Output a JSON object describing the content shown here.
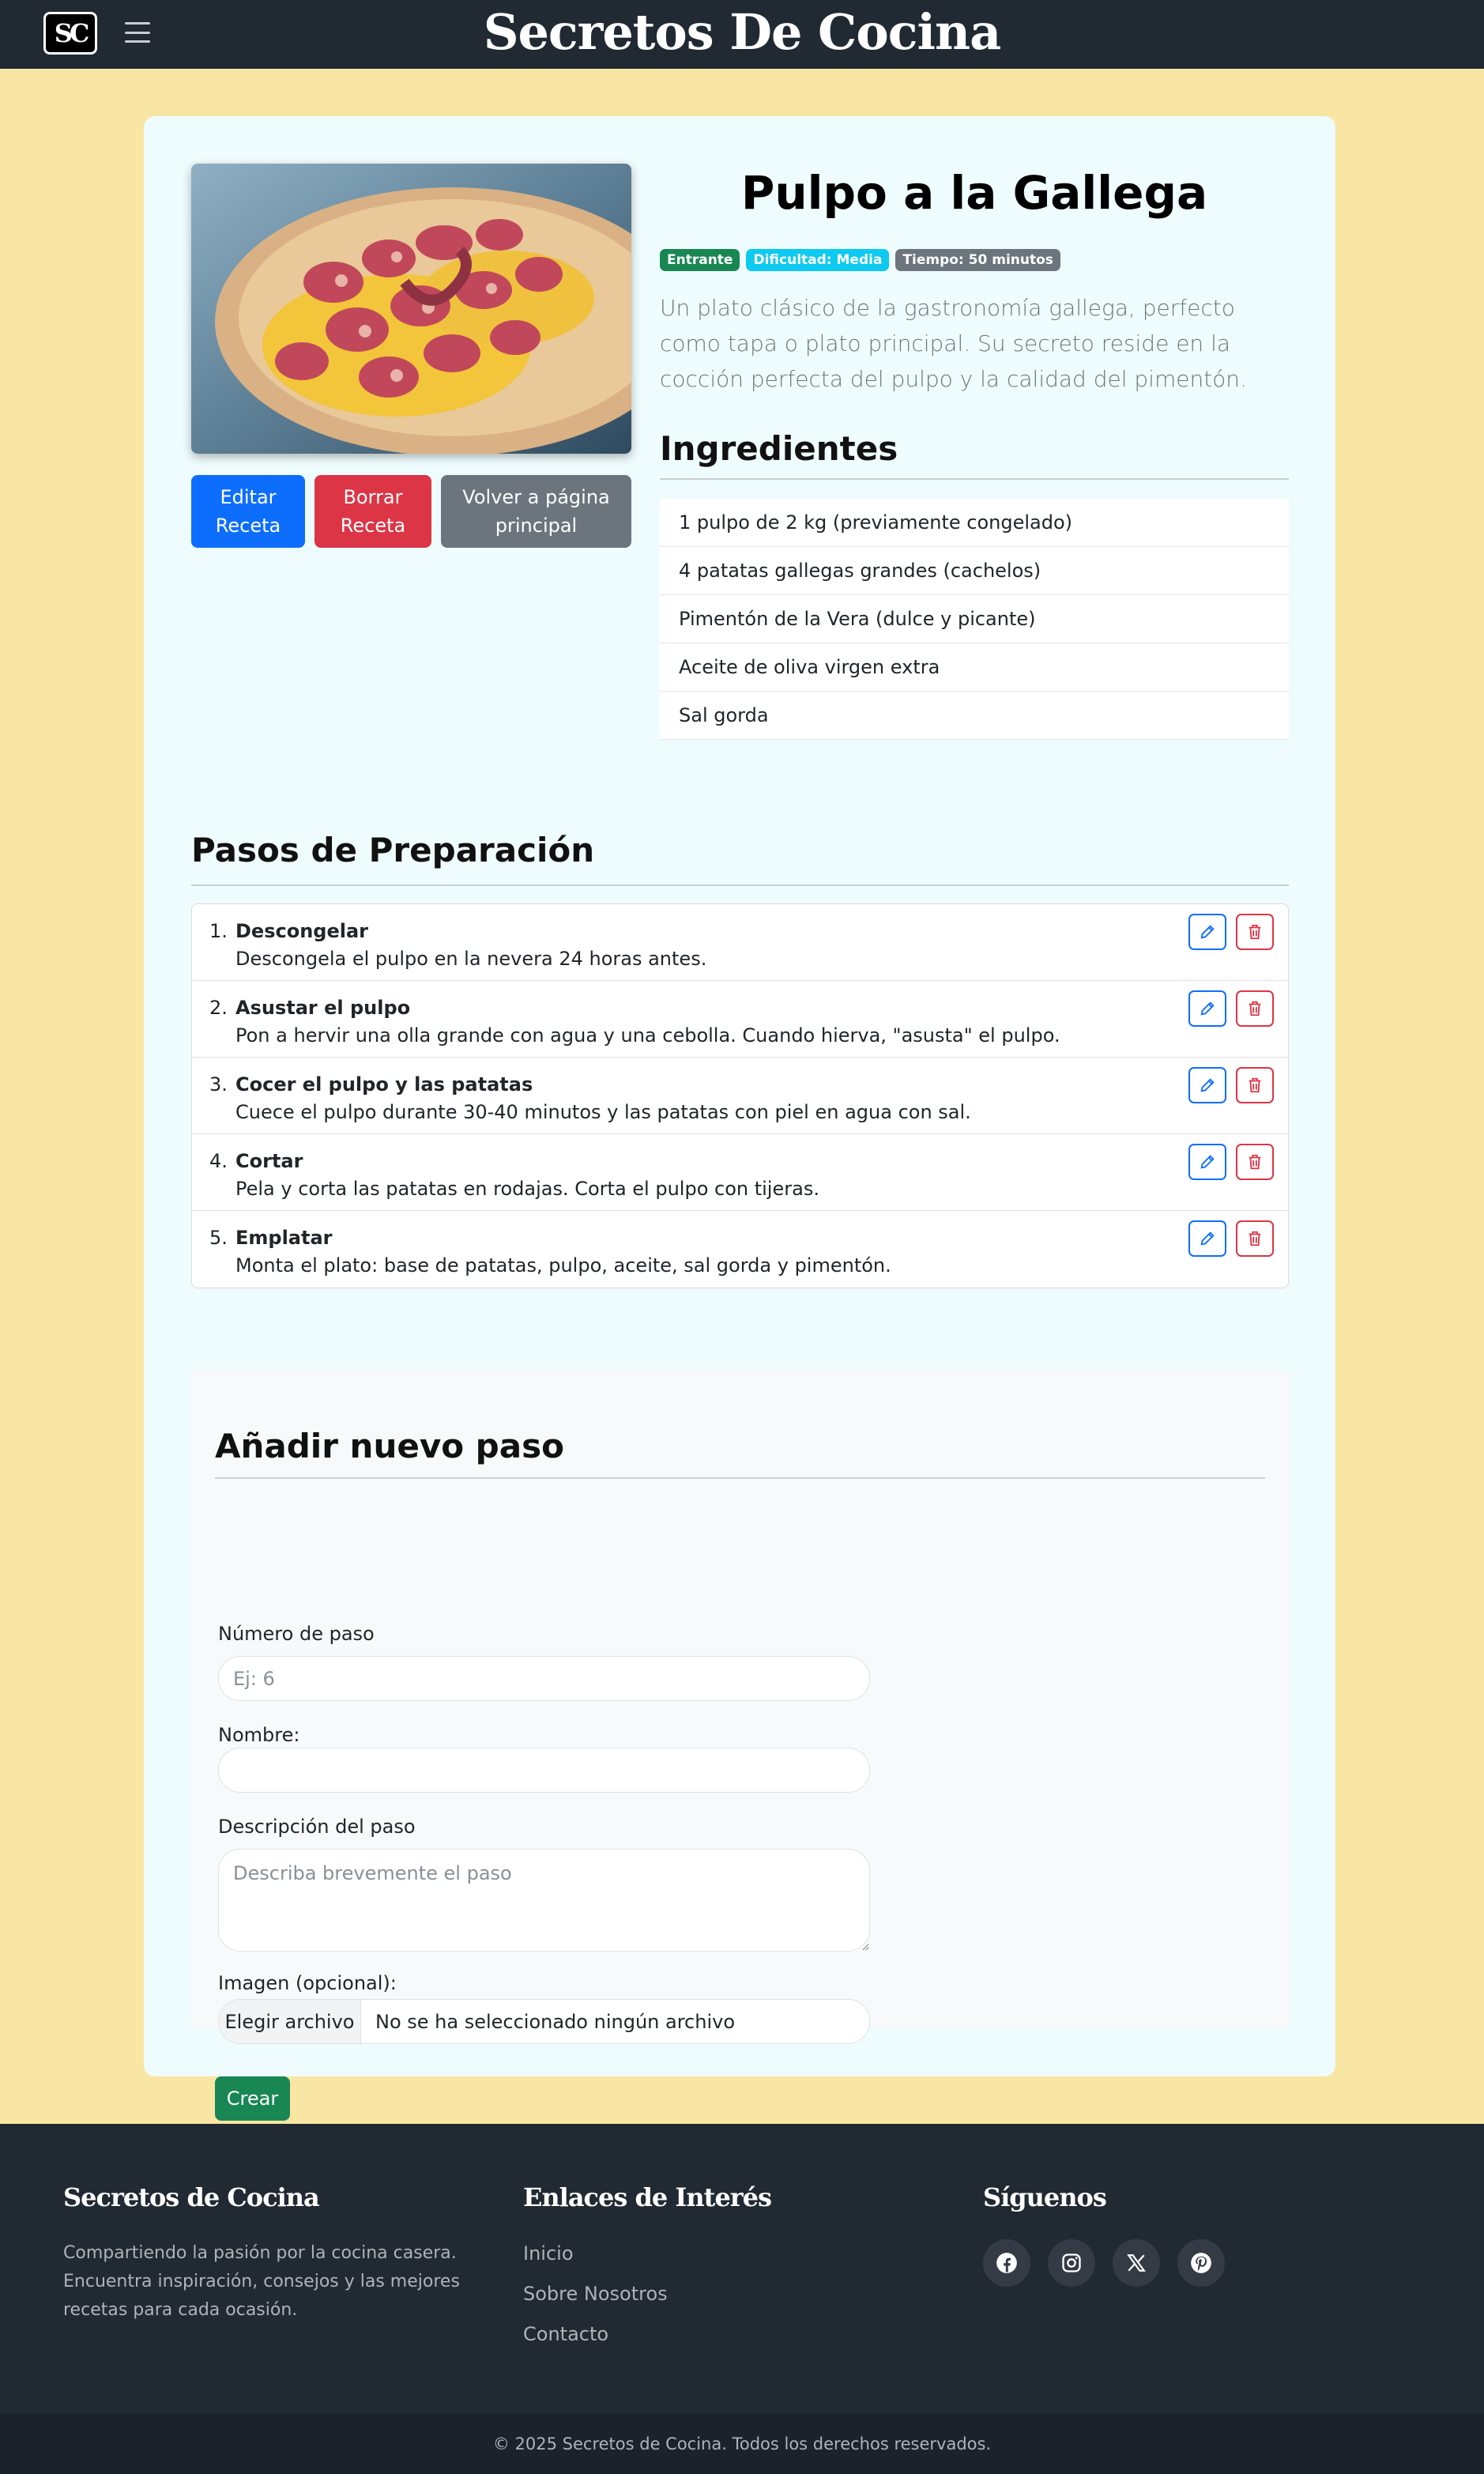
{
  "navbar": {
    "logo_text": "SC",
    "site_title": "Secretos De Cocina"
  },
  "recipe": {
    "title": "Pulpo a la Gallega",
    "badges": {
      "category": "Entrante",
      "difficulty": "Dificultad: Media",
      "time": "Tiempo: 50 minutos"
    },
    "description": "Un plato clásico de la gastronomía gallega, perfecto como tapa o plato principal. Su secreto reside en la cocción perfecta del pulpo y la calidad del pimentón.",
    "buttons": {
      "edit": "Editar Receta",
      "delete": "Borrar Receta",
      "back": "Volver a página principal"
    },
    "ingredients_heading": "Ingredientes",
    "ingredients": [
      "1 pulpo de 2 kg (previamente congelado)",
      "4 patatas gallegas grandes (cachelos)",
      "Pimentón de la Vera (dulce y picante)",
      "Aceite de oliva virgen extra",
      "Sal gorda"
    ]
  },
  "steps": {
    "heading": "Pasos de Preparación",
    "items": [
      {
        "num": "1.",
        "name": "Descongelar",
        "desc": "Descongela el pulpo en la nevera 24 horas antes."
      },
      {
        "num": "2.",
        "name": "Asustar el pulpo",
        "desc": "Pon a hervir una olla grande con agua y una cebolla. Cuando hierva, \"asusta\" el pulpo."
      },
      {
        "num": "3.",
        "name": "Cocer el pulpo y las patatas",
        "desc": "Cuece el pulpo durante 30-40 minutos y las patatas con piel en agua con sal."
      },
      {
        "num": "4.",
        "name": "Cortar",
        "desc": "Pela y corta las patatas en rodajas. Corta el pulpo con tijeras."
      },
      {
        "num": "5.",
        "name": "Emplatar",
        "desc": "Monta el plato: base de patatas, pulpo, aceite, sal gorda y pimentón."
      }
    ]
  },
  "add_step": {
    "heading": "Añadir nuevo paso",
    "number_label": "Número de paso",
    "number_placeholder": "Ej: 6",
    "name_label": "Nombre:",
    "desc_label": "Descripción del paso",
    "desc_placeholder": "Describa brevemente el paso",
    "image_label": "Imagen (opcional):",
    "file_button": "Elegir archivo",
    "file_status": "No se ha seleccionado ningún archivo",
    "submit": "Crear"
  },
  "footer": {
    "brand_heading": "Secretos de Cocina",
    "brand_text": "Compartiendo la pasión por la cocina casera. Encuentra inspiración, consejos y las mejores recetas para cada ocasión.",
    "links_heading": "Enlaces de Interés",
    "links": [
      "Inicio",
      "Sobre Nosotros",
      "Contacto"
    ],
    "social_heading": "Síguenos",
    "social_icons": [
      "facebook-icon",
      "instagram-icon",
      "x-icon",
      "pinterest-icon"
    ],
    "copyright": "© 2025 Secretos de Cocina. Todos los derechos reservados."
  },
  "colors": {
    "page_bg": "#f9e6a4",
    "navbar_bg": "#212a33",
    "card_bg": "#effcfd",
    "primary": "#0d6efd",
    "danger": "#dc3545",
    "secondary": "#6c757d",
    "success": "#198754",
    "info": "#0dcaf0"
  }
}
